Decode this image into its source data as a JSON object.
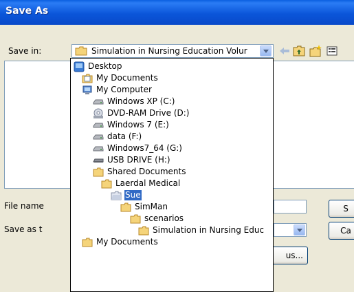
{
  "window": {
    "title": "Save As"
  },
  "save_in": {
    "label": "Save in:",
    "value": "Simulation in Nursing Education Volur"
  },
  "file_name": {
    "label": "File name"
  },
  "save_as_type": {
    "label": "Save as t"
  },
  "buttons": {
    "save_label": "S",
    "cancel_label": "Ca",
    "browse_label": "us..."
  },
  "dropdown_items": [
    {
      "label": "Desktop",
      "icon": "desktop-icon"
    },
    {
      "label": "My Documents",
      "icon": "documents-folder-icon"
    },
    {
      "label": "My Computer",
      "icon": "computer-icon"
    },
    {
      "label": "Windows XP (C:)",
      "icon": "hard-drive-icon"
    },
    {
      "label": "DVD-RAM Drive (D:)",
      "icon": "dvd-drive-icon"
    },
    {
      "label": "Windows 7 (E:)",
      "icon": "hard-drive-icon"
    },
    {
      "label": "data (F:)",
      "icon": "hard-drive-icon"
    },
    {
      "label": "Windows7_64 (G:)",
      "icon": "hard-drive-icon"
    },
    {
      "label": "USB DRIVE (H:)",
      "icon": "usb-drive-icon"
    },
    {
      "label": "Shared Documents",
      "icon": "folder-icon"
    },
    {
      "label": "Laerdal Medical",
      "icon": "folder-icon"
    },
    {
      "label": "Sue",
      "icon": "open-folder-icon",
      "selected": true
    },
    {
      "label": "SimMan",
      "icon": "folder-icon"
    },
    {
      "label": "scenarios",
      "icon": "folder-icon"
    },
    {
      "label": "Simulation in Nursing Educ",
      "icon": "folder-icon"
    },
    {
      "label": "My Documents",
      "icon": "folder-icon"
    }
  ],
  "colors": {
    "title_bar": "#0A5FE0",
    "selection": "#316AC5",
    "dialog_bg": "#ECE9D8"
  }
}
